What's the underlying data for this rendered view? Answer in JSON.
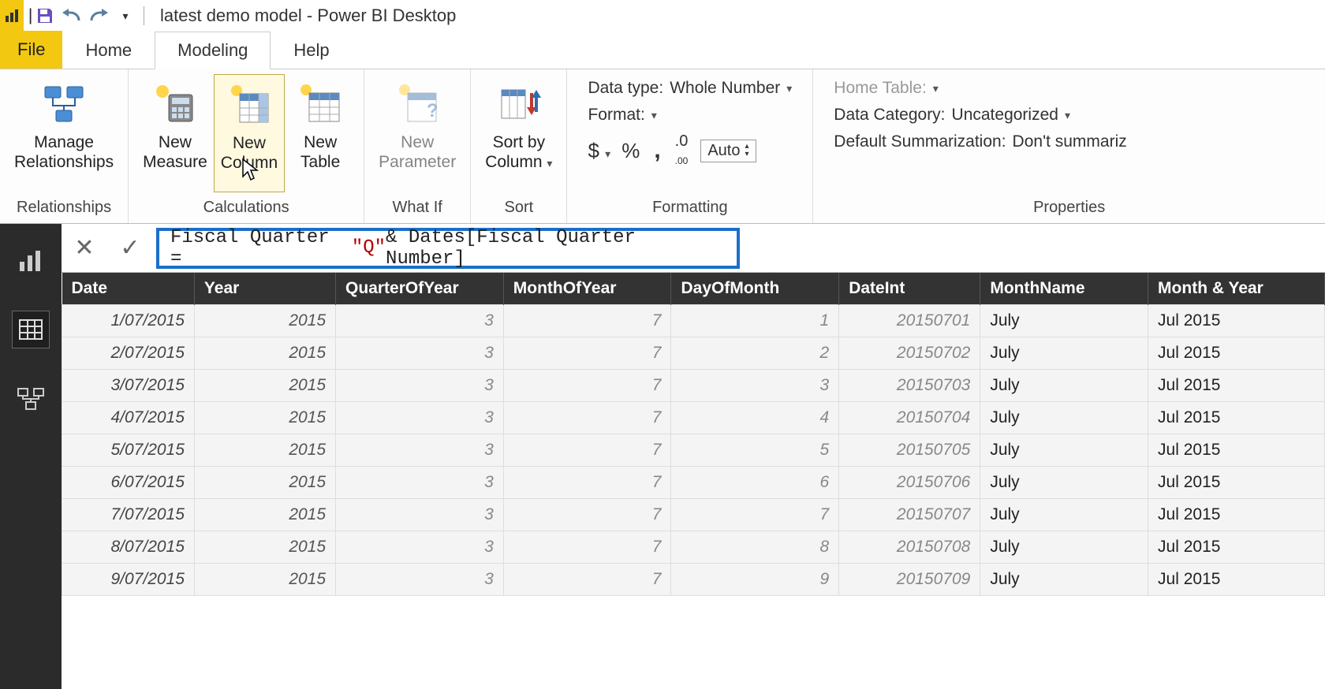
{
  "titlebar": {
    "title": "latest demo model - Power BI Desktop"
  },
  "tabs": {
    "file": "File",
    "home": "Home",
    "modeling": "Modeling",
    "help": "Help"
  },
  "ribbon": {
    "groups": {
      "relationships": {
        "label": "Relationships",
        "manage": "Manage\nRelationships"
      },
      "calculations": {
        "label": "Calculations",
        "new_measure": "New\nMeasure",
        "new_column": "New\nColumn",
        "new_table": "New\nTable"
      },
      "whatif": {
        "label": "What If",
        "new_parameter": "New\nParameter"
      },
      "sort": {
        "label": "Sort",
        "sort_by_column": "Sort by\nColumn"
      },
      "formatting": {
        "label": "Formatting",
        "data_type_label": "Data type:",
        "data_type_value": "Whole Number",
        "format_label": "Format:",
        "currency": "$",
        "percent": "%",
        "thousands": ",",
        "decimals_icon": ".0₀",
        "auto": "Auto"
      },
      "properties": {
        "label": "Properties",
        "home_table_label": "Home Table:",
        "data_category_label": "Data Category:",
        "data_category_value": "Uncategorized",
        "default_sum_label": "Default Summarization:",
        "default_sum_value": "Don't summariz"
      }
    }
  },
  "formula": {
    "prefix": "Fiscal Quarter = ",
    "string": "\"Q\"",
    "suffix": " & Dates[Fiscal Quarter Number]"
  },
  "grid": {
    "headers": [
      "Date",
      "Year",
      "QuarterOfYear",
      "MonthOfYear",
      "DayOfMonth",
      "DateInt",
      "MonthName",
      "Month & Year"
    ],
    "rows": [
      {
        "Date": "1/07/2015",
        "Year": "2015",
        "QuarterOfYear": "3",
        "MonthOfYear": "7",
        "DayOfMonth": "1",
        "DateInt": "20150701",
        "MonthName": "July",
        "MonthYear": "Jul 2015"
      },
      {
        "Date": "2/07/2015",
        "Year": "2015",
        "QuarterOfYear": "3",
        "MonthOfYear": "7",
        "DayOfMonth": "2",
        "DateInt": "20150702",
        "MonthName": "July",
        "MonthYear": "Jul 2015"
      },
      {
        "Date": "3/07/2015",
        "Year": "2015",
        "QuarterOfYear": "3",
        "MonthOfYear": "7",
        "DayOfMonth": "3",
        "DateInt": "20150703",
        "MonthName": "July",
        "MonthYear": "Jul 2015"
      },
      {
        "Date": "4/07/2015",
        "Year": "2015",
        "QuarterOfYear": "3",
        "MonthOfYear": "7",
        "DayOfMonth": "4",
        "DateInt": "20150704",
        "MonthName": "July",
        "MonthYear": "Jul 2015"
      },
      {
        "Date": "5/07/2015",
        "Year": "2015",
        "QuarterOfYear": "3",
        "MonthOfYear": "7",
        "DayOfMonth": "5",
        "DateInt": "20150705",
        "MonthName": "July",
        "MonthYear": "Jul 2015"
      },
      {
        "Date": "6/07/2015",
        "Year": "2015",
        "QuarterOfYear": "3",
        "MonthOfYear": "7",
        "DayOfMonth": "6",
        "DateInt": "20150706",
        "MonthName": "July",
        "MonthYear": "Jul 2015"
      },
      {
        "Date": "7/07/2015",
        "Year": "2015",
        "QuarterOfYear": "3",
        "MonthOfYear": "7",
        "DayOfMonth": "7",
        "DateInt": "20150707",
        "MonthName": "July",
        "MonthYear": "Jul 2015"
      },
      {
        "Date": "8/07/2015",
        "Year": "2015",
        "QuarterOfYear": "3",
        "MonthOfYear": "7",
        "DayOfMonth": "8",
        "DateInt": "20150708",
        "MonthName": "July",
        "MonthYear": "Jul 2015"
      },
      {
        "Date": "9/07/2015",
        "Year": "2015",
        "QuarterOfYear": "3",
        "MonthOfYear": "7",
        "DayOfMonth": "9",
        "DateInt": "20150709",
        "MonthName": "July",
        "MonthYear": "Jul 2015"
      }
    ]
  }
}
